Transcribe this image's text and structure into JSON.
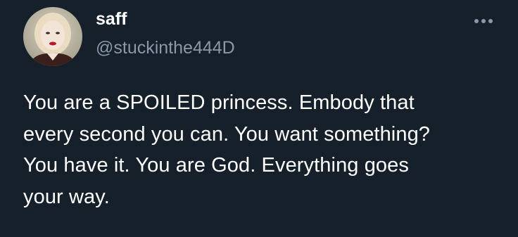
{
  "tweet": {
    "author": {
      "display_name": "saff",
      "handle": "@stuckinthe444D",
      "avatar_icon": "profile-avatar"
    },
    "more_icon": "ellipsis-icon",
    "text_lines": [
      "You are a SPOILED princess. Embody that",
      "every second you can. You want something?",
      "You have it. You are God. Everything goes",
      "your way."
    ]
  },
  "colors": {
    "background": "#15202b",
    "text_primary": "#ffffff",
    "text_secondary": "#8b98a5"
  }
}
